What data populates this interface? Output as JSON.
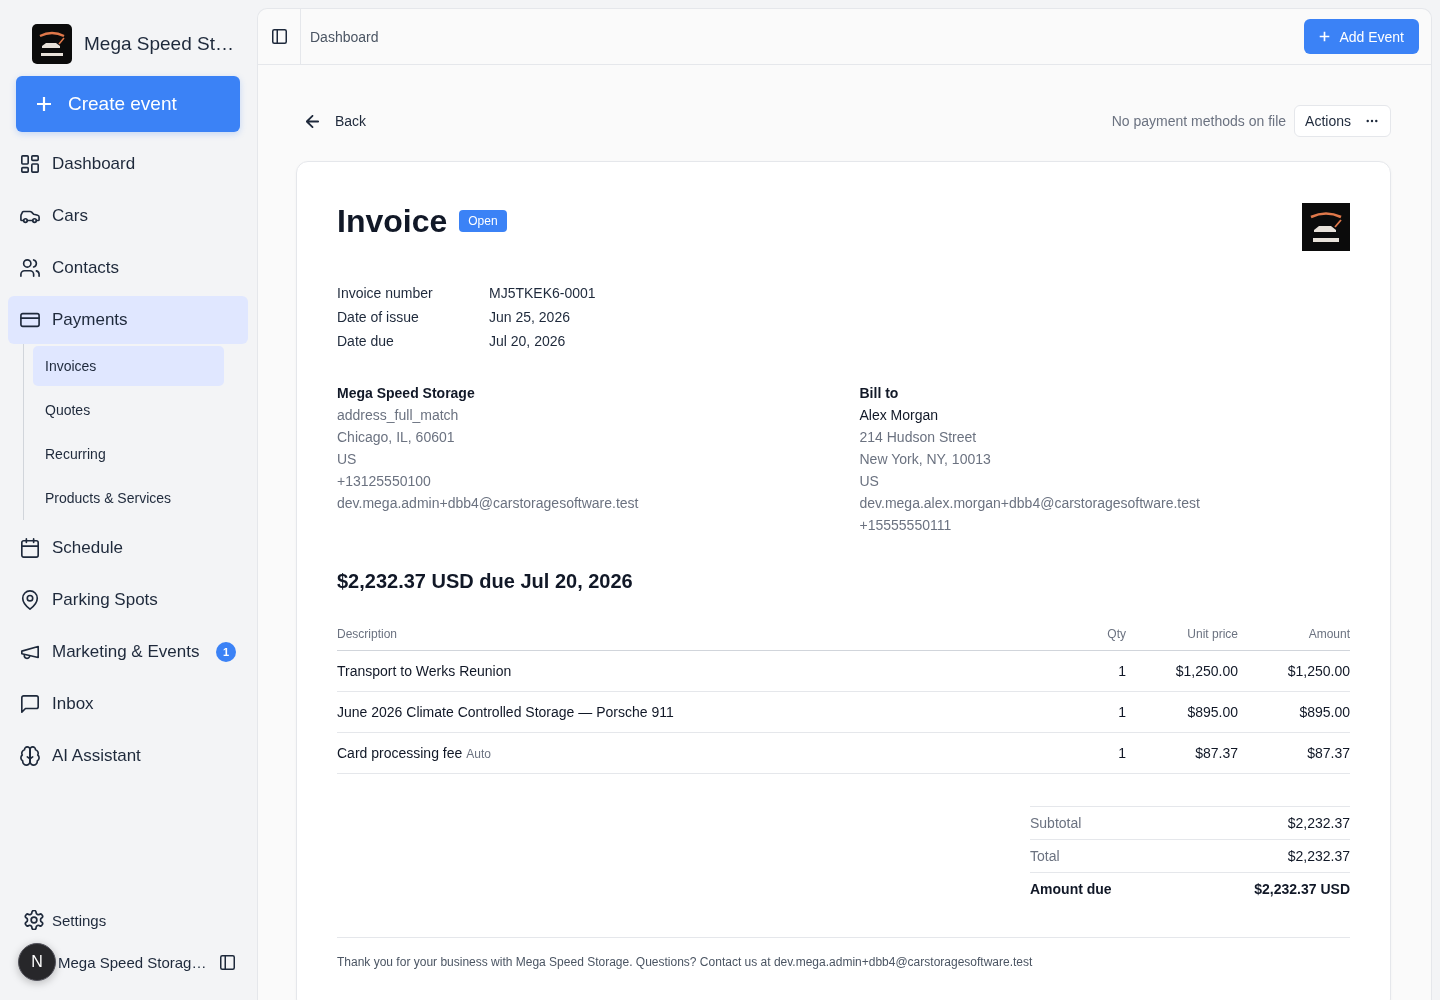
{
  "sidebar": {
    "brand": "Mega Speed St…",
    "create_button": "Create event",
    "items": [
      {
        "label": "Dashboard",
        "selected": false
      },
      {
        "label": "Cars",
        "selected": false
      },
      {
        "label": "Contacts",
        "selected": false
      },
      {
        "label": "Payments",
        "selected": true,
        "children": [
          {
            "label": "Invoices",
            "selected": true
          },
          {
            "label": "Quotes",
            "selected": false
          },
          {
            "label": "Recurring",
            "selected": false
          },
          {
            "label": "Products & Services",
            "selected": false
          }
        ]
      },
      {
        "label": "Schedule",
        "selected": false
      },
      {
        "label": "Parking Spots",
        "selected": false
      },
      {
        "label": "Marketing & Events",
        "selected": false,
        "badge": "1"
      },
      {
        "label": "Inbox",
        "selected": false
      },
      {
        "label": "AI Assistant",
        "selected": false
      }
    ],
    "settings": "Settings",
    "account": {
      "initial": "N",
      "name": "Mega Speed Storag…"
    }
  },
  "header": {
    "breadcrumb": "Dashboard",
    "add_button": "Add Event"
  },
  "toolbar": {
    "back": "Back",
    "payment_note": "No payment methods on file",
    "actions_button": "Actions"
  },
  "invoice": {
    "title": "Invoice",
    "status": "Open",
    "meta": [
      {
        "label": "Invoice number",
        "value": "MJ5TKEK6-0001"
      },
      {
        "label": "Date of issue",
        "value": "Jun 25, 2026"
      },
      {
        "label": "Date due",
        "value": "Jul 20, 2026"
      }
    ],
    "from": {
      "lines": [
        {
          "kind": "heading",
          "text": "Mega Speed Storage"
        },
        {
          "kind": "detail",
          "text": "address_full_match"
        },
        {
          "kind": "detail",
          "text": "Chicago, IL, 60601"
        },
        {
          "kind": "detail",
          "text": "US"
        },
        {
          "kind": "detail",
          "text": "+13125550100"
        },
        {
          "kind": "detail",
          "text": "dev.mega.admin+dbb4@carstoragesoftware.test"
        }
      ]
    },
    "bill_to": {
      "lines": [
        {
          "kind": "heading",
          "text": "Bill to"
        },
        {
          "kind": "name",
          "text": "Alex Morgan"
        },
        {
          "kind": "detail",
          "text": "214 Hudson Street"
        },
        {
          "kind": "detail",
          "text": "New York, NY, 10013"
        },
        {
          "kind": "detail",
          "text": "US"
        },
        {
          "kind": "detail",
          "text": "dev.mega.alex.morgan+dbb4@carstoragesoftware.test"
        },
        {
          "kind": "detail",
          "text": "+15555550111"
        }
      ]
    },
    "amount_heading": "$2,232.37 USD due Jul 20, 2026",
    "table": {
      "columns": [
        "Description",
        "Qty",
        "Unit price",
        "Amount"
      ],
      "rows": [
        {
          "description": "Transport to Werks Reunion",
          "qty": "1",
          "unit_price": "$1,250.00",
          "amount": "$1,250.00"
        },
        {
          "description": "June 2026 Climate Controlled Storage — Porsche 911",
          "qty": "1",
          "unit_price": "$895.00",
          "amount": "$895.00"
        },
        {
          "description": "Card processing fee",
          "note": "Auto",
          "qty": "1",
          "unit_price": "$87.37",
          "amount": "$87.37"
        }
      ]
    },
    "totals": [
      {
        "label": "Subtotal",
        "value": "$2,232.37",
        "strong": false
      },
      {
        "label": "Total",
        "value": "$2,232.37",
        "strong": false
      },
      {
        "label": "Amount due",
        "value": "$2,232.37 USD",
        "strong": true
      }
    ],
    "footer": "Thank you for your business with Mega Speed Storage. Questions? Contact us at dev.mega.admin+dbb4@carstoragesoftware.test"
  }
}
